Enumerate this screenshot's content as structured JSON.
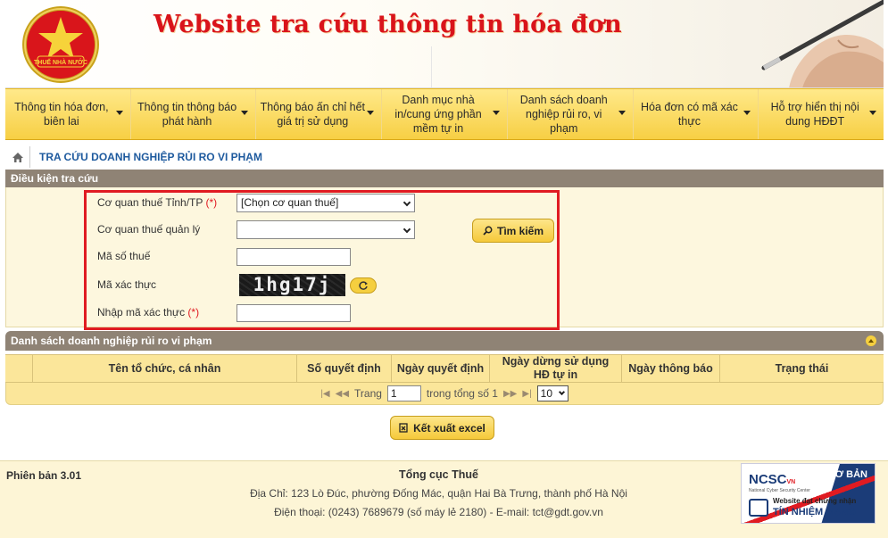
{
  "header": {
    "emblem_text": "THUẾ NHÀ NƯỚC",
    "site_title": "Website tra cứu thông tin hóa đơn"
  },
  "nav": [
    {
      "label": "Thông tin hóa đơn, biên lai"
    },
    {
      "label": "Thông tin thông báo phát hành"
    },
    {
      "label": "Thông báo ấn chỉ hết giá trị sử dụng"
    },
    {
      "label": "Danh mục nhà in/cung ứng phần mềm tự in"
    },
    {
      "label": "Danh sách doanh nghiệp rủi ro, vi phạm"
    },
    {
      "label": "Hóa đơn có mã xác thực"
    },
    {
      "label": "Hỗ trợ hiển thị nội dung HĐĐT"
    }
  ],
  "breadcrumb": {
    "current": "TRA CỨU DOANH NGHIỆP RỦI RO VI PHẠM"
  },
  "search": {
    "title": "Điều kiện tra cứu",
    "province_label": "Cơ quan thuế Tỉnh/TP",
    "province_required": "(*)",
    "province_value": "[Chọn cơ quan thuế]",
    "managing_label": "Cơ quan thuế quản lý",
    "managing_value": "",
    "tax_code_label": "Mã số thuế",
    "tax_code_value": "",
    "captcha_label": "Mã xác thực",
    "captcha_text": "1hg17j",
    "enter_captcha_label": "Nhập mã xác thực",
    "enter_captcha_required": "(*)",
    "enter_captcha_value": "",
    "search_button": "Tìm kiếm"
  },
  "results": {
    "title": "Danh sách doanh nghiệp rủi ro vi phạm",
    "columns": [
      "",
      "Tên tổ chức, cá nhân",
      "Số quyết định",
      "Ngày quyết định",
      "Ngày dừng sử dụng HĐ tự in",
      "Ngày thông báo",
      "Trạng thái"
    ],
    "pager": {
      "page_label": "Trang",
      "page_value": "1",
      "total_label": "trong tổng số 1",
      "page_size": "10"
    },
    "export_button": "Kết xuất excel"
  },
  "footer": {
    "version": "Phiên bản 3.01",
    "org": "Tổng cục Thuế",
    "address": "Địa Chỉ: 123 Lò Đúc, phường Đống Mác, quận Hai Bà Trưng, thành phố Hà Nội",
    "contact": "Điện thoại: (0243) 7689679 (số máy lẻ 2180) - E-mail: tct@gdt.gov.vn",
    "badge": {
      "level": "CƠ BẢN",
      "logo": "NCSC",
      "logo_vn": "VN",
      "sub": "National Cyber Security Center",
      "site": "Website đạt chứng nhận",
      "trust": "TÍN NHIỆM MẠNG"
    }
  },
  "colors": {
    "accent_red": "#e01b22",
    "nav_yellow": "#f7cf44",
    "panel_header": "#8f8375",
    "link_blue": "#1e5a9e"
  }
}
